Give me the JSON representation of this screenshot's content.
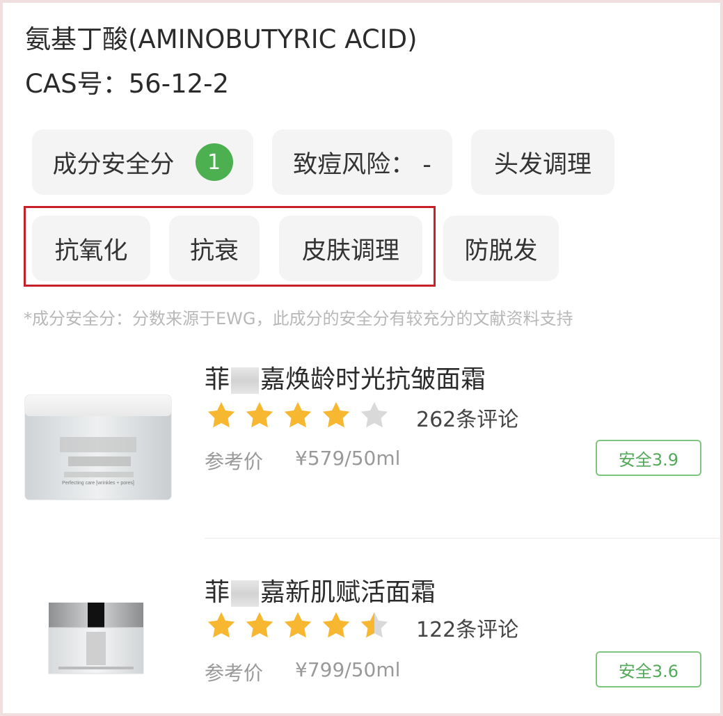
{
  "ingredient": {
    "title": "氨基丁酸(AMINOBUTYRIC ACID)",
    "cas": "CAS号：56-12-2"
  },
  "tags": {
    "safety_label": "成分安全分",
    "safety_score": "1",
    "acne_risk": "致痘风险：  -",
    "hair": "头发调理",
    "antioxidant": "抗氧化",
    "anti_aging": "抗衰",
    "skin": "皮肤调理",
    "hair_loss": "防脱发"
  },
  "note": "*成分安全分：分数来源于EWG，此成分的安全分有较充分的文献资料支持",
  "products": [
    {
      "name_prefix": "菲",
      "name_suffix": "嘉焕龄时光抗皱面霜",
      "rating": 4,
      "reviews": "262条评论",
      "price_label": "参考价",
      "price": "¥579/50ml",
      "safety": "安全3.9",
      "jar_caption": "Perfecting care [wrinkles + pores]"
    },
    {
      "name_prefix": "菲",
      "name_suffix": "嘉新肌赋活面霜",
      "rating": 4.5,
      "reviews": "122条评论",
      "price_label": "参考价",
      "price": "¥799/50ml",
      "safety": "安全3.6"
    }
  ],
  "colors": {
    "star_on": "#f7b731",
    "star_off": "#d9d9d9",
    "score_green": "#4caf50",
    "highlight_red": "#c8202a"
  }
}
